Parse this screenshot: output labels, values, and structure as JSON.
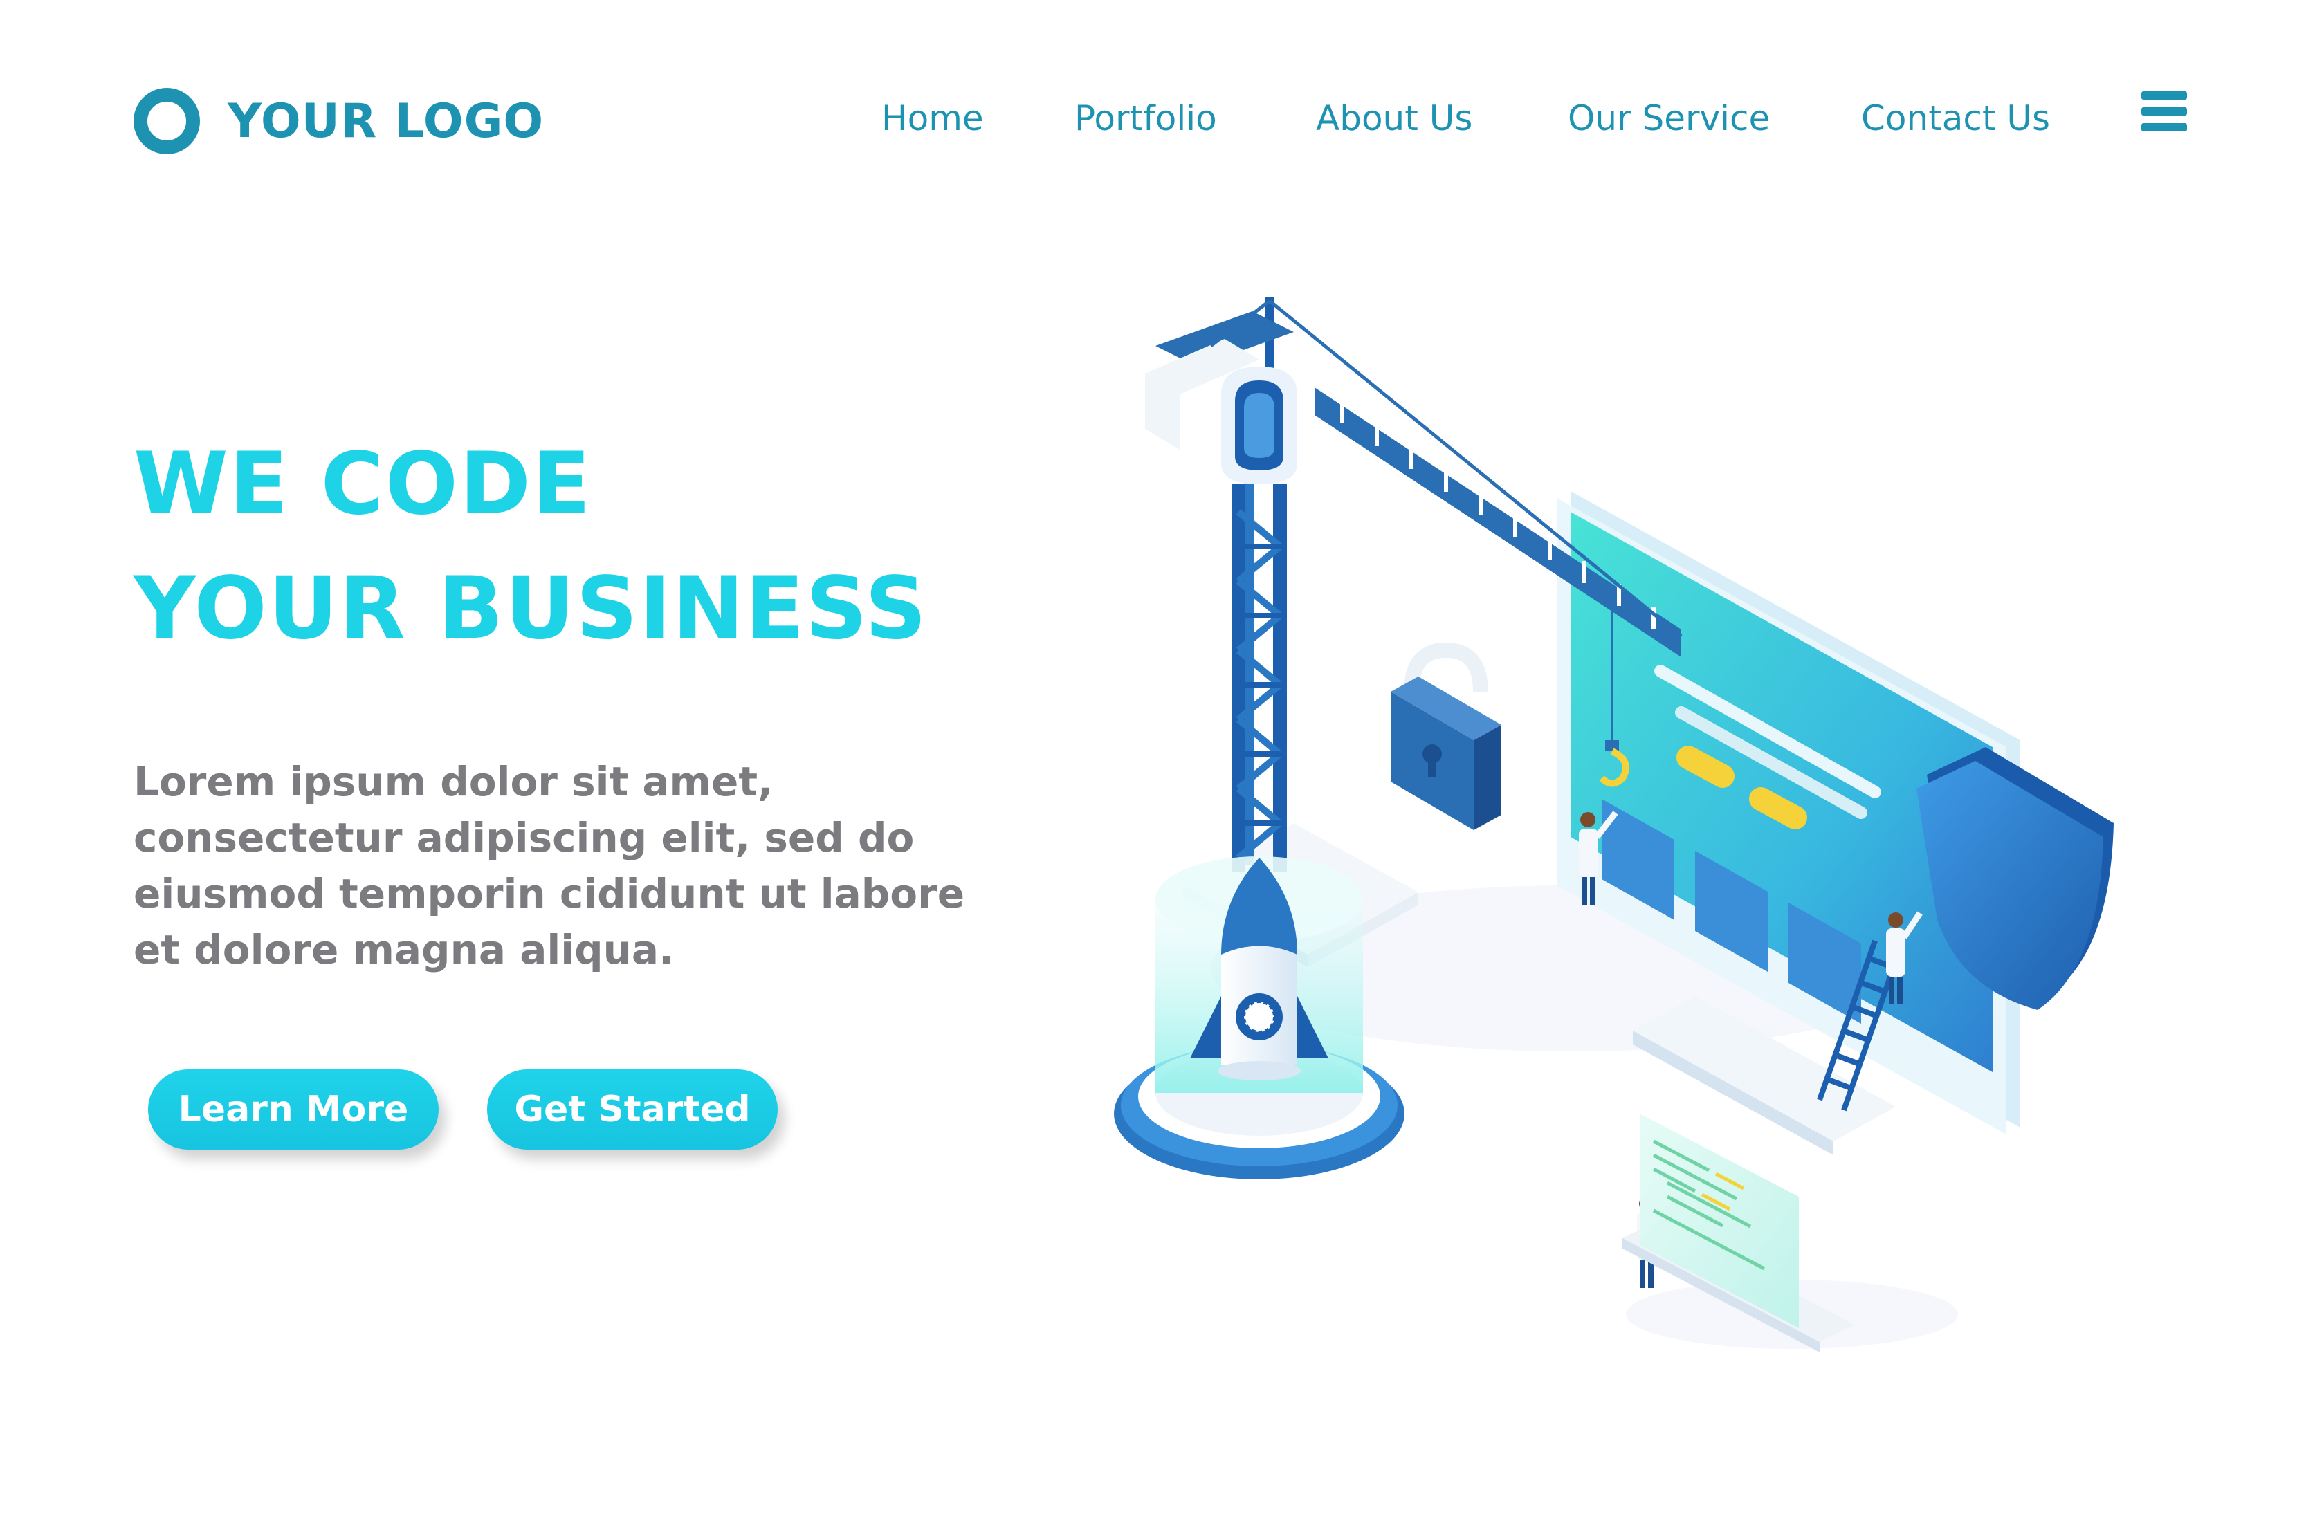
{
  "header": {
    "logo_text": "YOUR LOGO",
    "nav": [
      {
        "label": "Home"
      },
      {
        "label": "Portfolio"
      },
      {
        "label": "About Us"
      },
      {
        "label": "Our Service"
      },
      {
        "label": "Contact Us"
      }
    ],
    "menu_icon": "hamburger-menu-icon"
  },
  "hero": {
    "title_lines": [
      "WE CODE",
      "YOUR BUSINESS"
    ],
    "body_lines": [
      "Lorem ipsum dolor sit amet,",
      "consectetur adipiscing elit, sed do",
      "eiusmod temporin cididunt ut labore",
      "et dolore magna aliqua."
    ],
    "buttons": {
      "learn_more": "Learn More",
      "get_started": "Get Started"
    }
  },
  "illustration": {
    "elements": [
      "crane-icon",
      "rocket-icon",
      "padlock-icon",
      "shield-icon",
      "monitor-icon",
      "ladder-icon",
      "developer-figure-icon",
      "code-panel-icon"
    ]
  },
  "colors": {
    "primary": "#1e93b1",
    "accent": "#1ed3e6",
    "body_text": "#7b7b80",
    "button": "#1fd3e9",
    "crane": "#2a6fb4",
    "screen": "#3fd8d6",
    "highlight": "#f5d13a"
  }
}
